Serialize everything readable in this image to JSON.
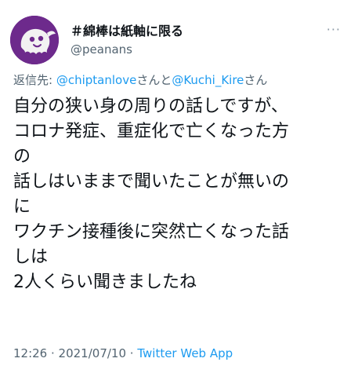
{
  "user": {
    "display_name": "＃綿棒は紙軸に限る",
    "handle": "@peanans",
    "avatar_icon": "ghost-avatar-icon",
    "avatar_color": "#6d2a8c"
  },
  "more_menu": {
    "label": "···"
  },
  "reply": {
    "prefix": "返信先: ",
    "mention_1": "@chiptanlove",
    "joiner": "さんと",
    "mention_2": "@Kuchi_Kire",
    "suffix": "さん"
  },
  "tweet": {
    "lines": [
      "自分の狭い身の周りの話しですが、",
      "コロナ発症、重症化で亡くなった方",
      "の",
      "話しはいままで聞いたことが無いの",
      "に",
      "ワクチン接種後に突然亡くなった話",
      "しは",
      "2人くらい聞きましたね"
    ]
  },
  "meta": {
    "time": "12:26",
    "separator_1": " · ",
    "date": "2021/07/10",
    "separator_2": " · ",
    "source": "Twitter Web App"
  },
  "colors": {
    "text": "#0f1419",
    "secondary": "#536471",
    "link": "#1d9bf0"
  }
}
